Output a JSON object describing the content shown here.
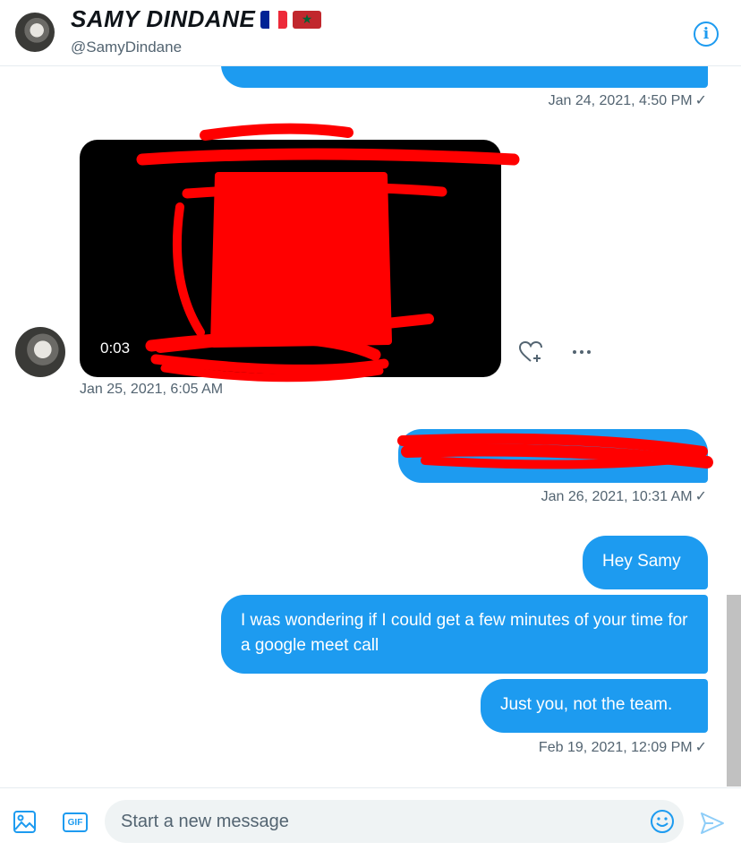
{
  "header": {
    "name": "SAMY DINDANE",
    "handle": "@SamyDindane",
    "flags": [
      "france-flag",
      "morocco-flag"
    ],
    "info_icon": "info-icon"
  },
  "messages": [
    {
      "direction": "out",
      "text": "",
      "redacted": true,
      "partially_visible": true
    },
    {
      "direction": "out",
      "timestamp": "Jan 24, 2021, 4:50 PM",
      "seen": "✓"
    },
    {
      "direction": "in",
      "type": "video",
      "duration": "0:03",
      "redacted": true,
      "timestamp": "Jan 25, 2021, 6:05 AM"
    },
    {
      "direction": "out",
      "text": "",
      "redacted": true,
      "timestamp": "Jan 26, 2021, 10:31 AM",
      "seen": "✓"
    },
    {
      "direction": "out",
      "text": "Hey Samy"
    },
    {
      "direction": "out",
      "text": "I was wondering if I could get a few minutes of your time for a google meet call"
    },
    {
      "direction": "out",
      "text": "Just you, not the team.",
      "timestamp": "Feb 19, 2021, 12:09 PM",
      "seen": "✓"
    }
  ],
  "composer": {
    "placeholder": "Start a new message",
    "value": "",
    "gif_label": "GIF",
    "icons": [
      "image-icon",
      "gif-icon",
      "emoji-icon",
      "send-icon"
    ]
  },
  "colors": {
    "accent": "#1d9bf0",
    "secondary_text": "#536471",
    "redaction": "#ff0000"
  }
}
